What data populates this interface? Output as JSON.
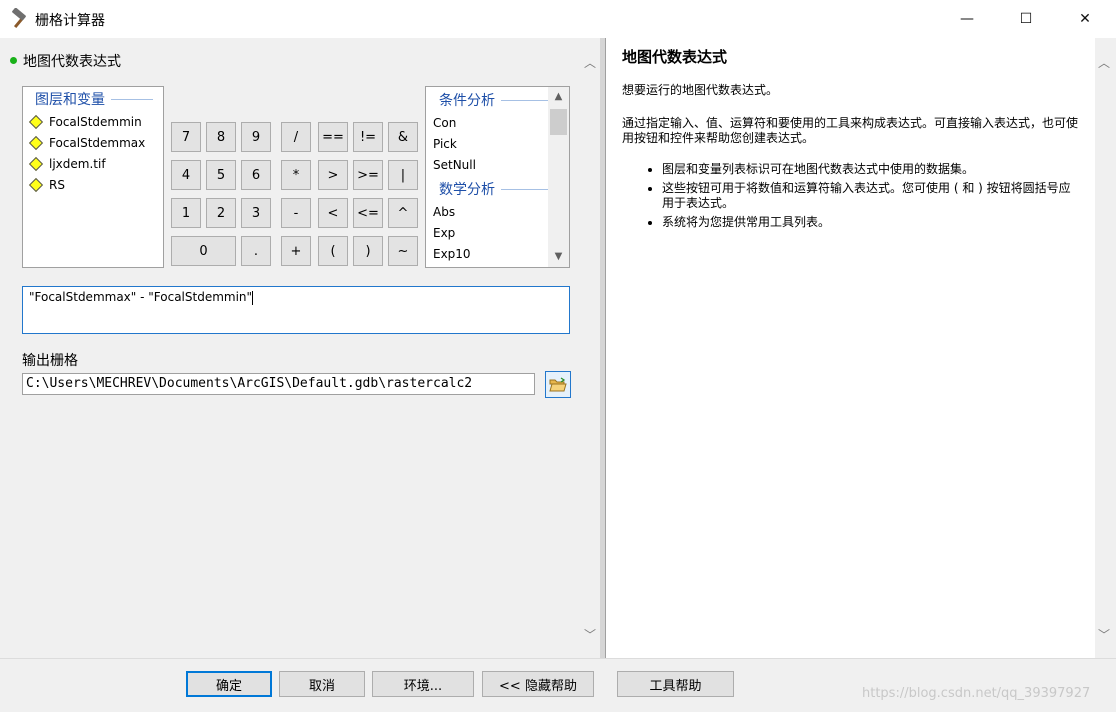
{
  "window": {
    "title": "栅格计算器",
    "icon": "hammer-icon",
    "controls": {
      "minimize": "—",
      "maximize": "☐",
      "close": "✕"
    }
  },
  "section": {
    "title": "地图代数表达式"
  },
  "layers_panel": {
    "heading": "图层和变量",
    "items": [
      "FocalStdemmin",
      "FocalStdemmax",
      "ljxdem.tif",
      "RS"
    ]
  },
  "calculator": {
    "rows": [
      [
        "7",
        "8",
        "9",
        "/",
        "==",
        "!=",
        "&"
      ],
      [
        "4",
        "5",
        "6",
        "*",
        ">",
        ">=",
        "|"
      ],
      [
        "1",
        "2",
        "3",
        "-",
        "<",
        "<=",
        "^"
      ],
      [
        "0",
        ".",
        "+",
        "(",
        ")",
        "~"
      ]
    ]
  },
  "functions_panel": {
    "group1": "条件分析",
    "group1_items": [
      "Con",
      "Pick",
      "SetNull"
    ],
    "group2": "数学分析",
    "group2_items": [
      "Abs",
      "Exp",
      "Exp10"
    ]
  },
  "expression": {
    "value": "\"FocalStdemmax\" - \"FocalStdemmin\""
  },
  "output": {
    "label": "输出栅格",
    "value": "C:\\Users\\MECHREV\\Documents\\ArcGIS\\Default.gdb\\rastercalc2",
    "browse_icon": "folder-open-icon"
  },
  "help": {
    "title": "地图代数表达式",
    "intro": "想要运行的地图代数表达式。",
    "paragraph": "通过指定输入、值、运算符和要使用的工具来构成表达式。可直接输入表达式，也可使用按钮和控件来帮助您创建表达式。",
    "bullets": [
      "图层和变量列表标识可在地图代数表达式中使用的数据集。",
      "这些按钮可用于将数值和运算符输入表达式。您可使用 ( 和 ) 按钮将圆括号应用于表达式。",
      "系统将为您提供常用工具列表。"
    ]
  },
  "buttons": {
    "ok": "确定",
    "cancel": "取消",
    "env": "环境...",
    "hide_help": "<< 隐藏帮助",
    "tool_help": "工具帮助"
  },
  "watermark": "https://blog.csdn.net/qq_39397927",
  "colors": {
    "accent": "#0078d7",
    "heading_blue": "#1e4fa8",
    "layer_diamond": "#ffff1a",
    "bullet_green": "#19b119"
  }
}
